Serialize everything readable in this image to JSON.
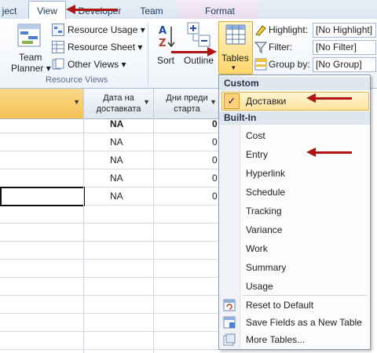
{
  "tabs": {
    "project": "ject",
    "view": "View",
    "developer": "Developer",
    "team": "Team",
    "format": "Format"
  },
  "ribbon": {
    "team_planner": "Team",
    "team_planner_2": "Planner",
    "resource_usage": "Resource Usage",
    "resource_sheet": "Resource Sheet",
    "other_views": "Other Views",
    "group_resource_views": "Resource Views",
    "sort": "Sort",
    "outline": "Outline",
    "tables": "Tables",
    "highlight_label": "Highlight:",
    "highlight_value": "[No Highlight]",
    "filter_label": "Filter:",
    "filter_value": "[No Filter]",
    "groupby_label": "Group by:",
    "groupby_value": "[No Group]"
  },
  "grid": {
    "col1_line1": "Дата на",
    "col1_line2": "доставката",
    "col2_line1": "Дни преди",
    "col2_line2": "старта",
    "rows": [
      {
        "a": "NA",
        "b": "0"
      },
      {
        "a": "NA",
        "b": "0"
      },
      {
        "a": "NA",
        "b": "0"
      },
      {
        "a": "NA",
        "b": "0"
      },
      {
        "a": "NA",
        "b": "0"
      }
    ]
  },
  "menu": {
    "custom_header": "Custom",
    "custom_item": "Доставки",
    "builtin_header": "Built-In",
    "builtin_items": [
      "Cost",
      "Entry",
      "Hyperlink",
      "Schedule",
      "Tracking",
      "Variance",
      "Work",
      "Summary",
      "Usage"
    ],
    "reset": "Reset to Default",
    "save_fields": "Save Fields as a New Table",
    "more_tables": "More Tables..."
  },
  "colors": {
    "arrow": "#b01515",
    "accent": "#1e395b"
  }
}
